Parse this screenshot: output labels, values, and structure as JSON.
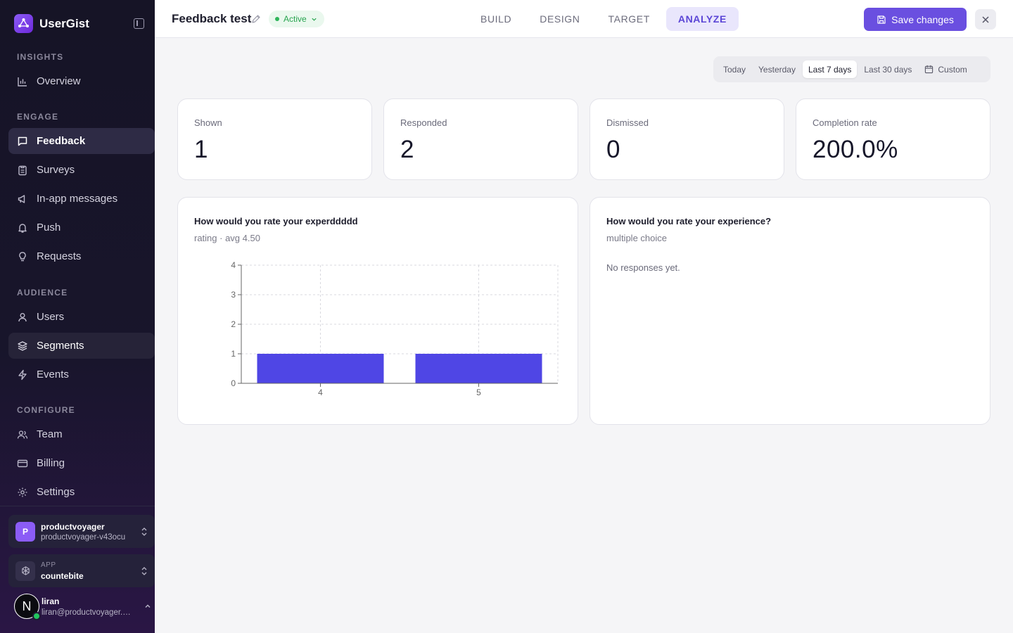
{
  "sidebar": {
    "brand": "UserGist",
    "sections": {
      "insights": "INSIGHTS",
      "engage": "ENGAGE",
      "audience": "AUDIENCE",
      "configure": "CONFIGURE"
    },
    "items": {
      "overview": "Overview",
      "feedback": "Feedback",
      "surveys": "Surveys",
      "inapp": "In-app messages",
      "push": "Push",
      "requests": "Requests",
      "users": "Users",
      "segments": "Segments",
      "events": "Events",
      "team": "Team",
      "billing": "Billing",
      "settings": "Settings"
    },
    "org": {
      "avatar": "P",
      "name": "productvoyager",
      "slug": "productvoyager-v43ocu"
    },
    "app": {
      "label": "APP",
      "name": "countebite"
    },
    "user": {
      "initial": "N",
      "name": "liran",
      "email": "liran@productvoyager.co..."
    }
  },
  "header": {
    "title": "Feedback test",
    "status": "Active",
    "tabs": {
      "build": "BUILD",
      "design": "DESIGN",
      "target": "TARGET",
      "analyze": "ANALYZE"
    },
    "save_label": "Save changes"
  },
  "date_filter": {
    "today": "Today",
    "yesterday": "Yesterday",
    "last7": "Last 7 days",
    "last30": "Last 30 days",
    "custom": "Custom",
    "selected": "Last 7 days"
  },
  "stats": {
    "shown": {
      "label": "Shown",
      "value": "1"
    },
    "responded": {
      "label": "Responded",
      "value": "2"
    },
    "dismissed": {
      "label": "Dismissed",
      "value": "0"
    },
    "completion": {
      "label": "Completion rate",
      "value": "200.0%"
    }
  },
  "questions": {
    "q1": {
      "title": "How would you rate your experddddd",
      "subtitle": "rating · avg 4.50"
    },
    "q2": {
      "title": "How would you rate your experience?",
      "subtitle": "multiple choice",
      "empty": "No responses yet."
    }
  },
  "colors": {
    "accent": "#6a4fe0",
    "bar": "#4f46e5",
    "active_status": "#27a44f"
  },
  "chart_data": {
    "type": "bar",
    "categories": [
      "4",
      "5"
    ],
    "values": [
      1,
      1
    ],
    "ylim": [
      0,
      4
    ],
    "yticks": [
      "0",
      "1",
      "2",
      "3",
      "4"
    ],
    "grid": true
  }
}
